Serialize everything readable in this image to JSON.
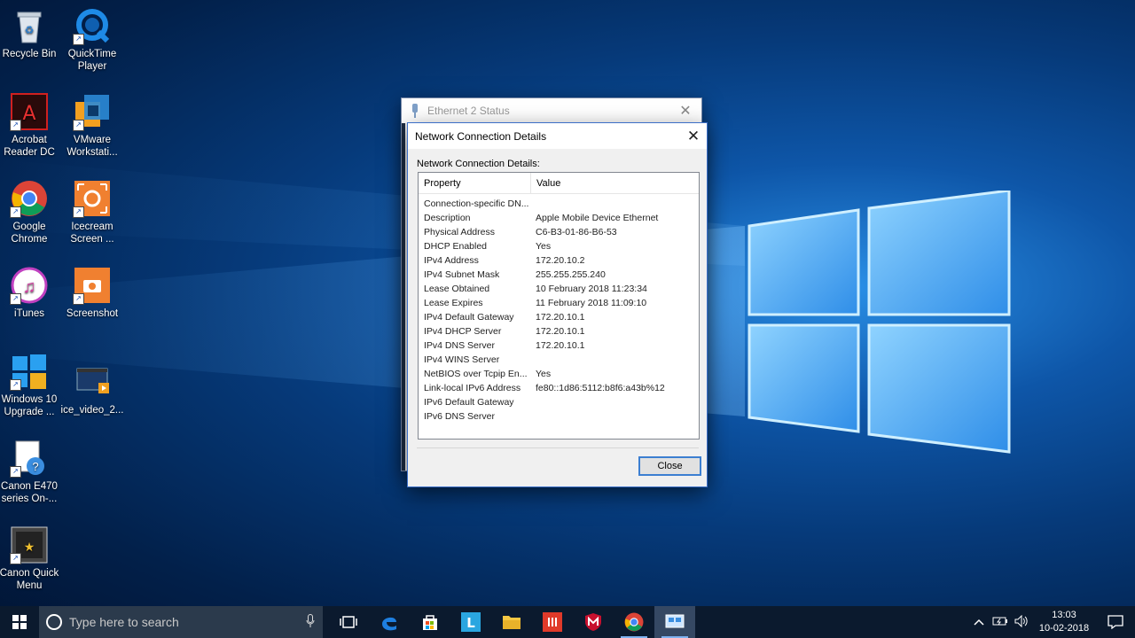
{
  "desktop": {
    "icons": [
      {
        "label": "Recycle Bin"
      },
      {
        "label": "QuickTime Player"
      },
      {
        "label": "Acrobat Reader DC"
      },
      {
        "label": "VMware Workstati..."
      },
      {
        "label": "Google Chrome"
      },
      {
        "label": "Icecream Screen ..."
      },
      {
        "label": "iTunes"
      },
      {
        "label": "Screenshot"
      },
      {
        "label": "Windows 10 Upgrade ..."
      },
      {
        "label": "ice_video_2..."
      },
      {
        "label": "Canon E470 series On-..."
      },
      {
        "label": "Canon Quick Menu"
      }
    ]
  },
  "ethernet_window": {
    "title": "Ethernet 2 Status",
    "close_glyph": "✕"
  },
  "details_dialog": {
    "title": "Network Connection Details",
    "close_glyph": "✕",
    "section_label": "Network Connection Details:",
    "columns": {
      "property": "Property",
      "value": "Value"
    },
    "rows": [
      {
        "property": "Connection-specific DN...",
        "value": ""
      },
      {
        "property": "Description",
        "value": "Apple Mobile Device Ethernet"
      },
      {
        "property": "Physical Address",
        "value": "C6-B3-01-86-B6-53"
      },
      {
        "property": "DHCP Enabled",
        "value": "Yes"
      },
      {
        "property": "IPv4 Address",
        "value": "172.20.10.2"
      },
      {
        "property": "IPv4 Subnet Mask",
        "value": "255.255.255.240"
      },
      {
        "property": "Lease Obtained",
        "value": "10 February 2018 11:23:34"
      },
      {
        "property": "Lease Expires",
        "value": "11 February 2018 11:09:10"
      },
      {
        "property": "IPv4 Default Gateway",
        "value": "172.20.10.1"
      },
      {
        "property": "IPv4 DHCP Server",
        "value": "172.20.10.1"
      },
      {
        "property": "IPv4 DNS Server",
        "value": "172.20.10.1"
      },
      {
        "property": "IPv4 WINS Server",
        "value": ""
      },
      {
        "property": "NetBIOS over Tcpip En...",
        "value": "Yes"
      },
      {
        "property": "Link-local IPv6 Address",
        "value": "fe80::1d86:5112:b8f6:a43b%12"
      },
      {
        "property": "IPv6 Default Gateway",
        "value": ""
      },
      {
        "property": "IPv6 DNS Server",
        "value": ""
      }
    ],
    "close_button": "Close"
  },
  "taskbar": {
    "search_placeholder": "Type here to search",
    "apps": [
      "task-view",
      "edge",
      "store",
      "l-app",
      "file-explorer",
      "app-red",
      "mcafee",
      "chrome",
      "network-settings"
    ],
    "time": "13:03",
    "date": "10-02-2018"
  },
  "colors": {
    "accent": "#3c7fd1",
    "taskbar": "#0b1a2e"
  }
}
